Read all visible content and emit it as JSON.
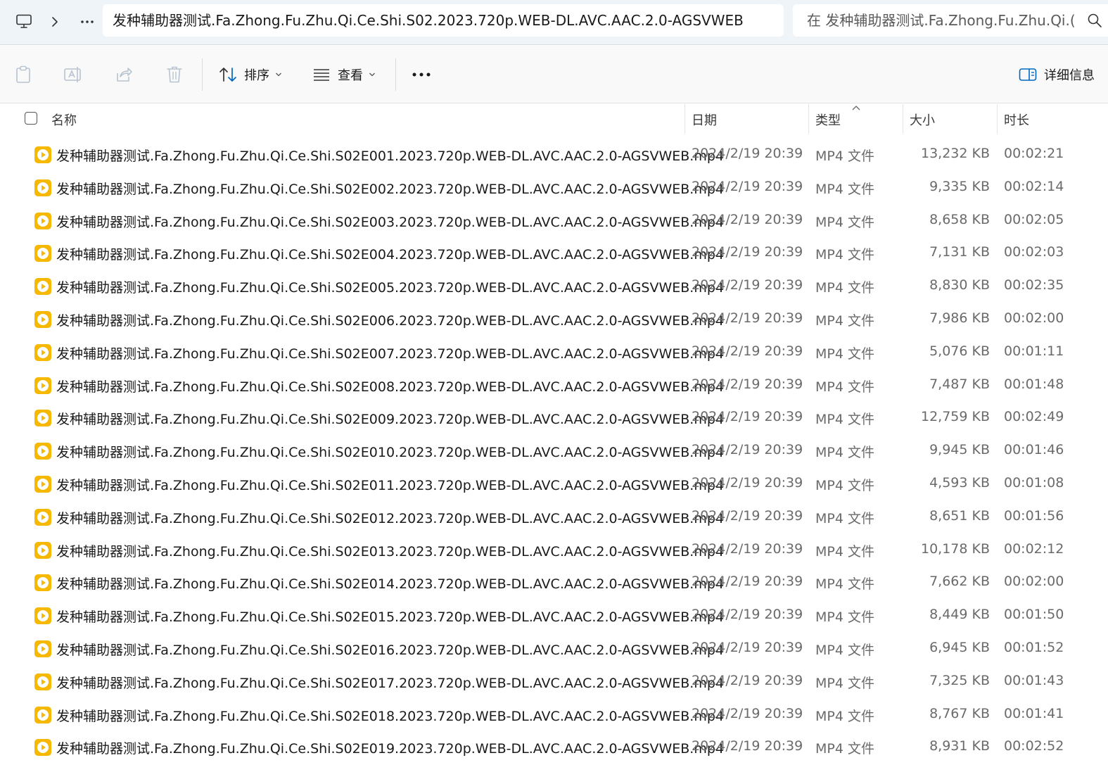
{
  "address_bar": {
    "breadcrumb": "发种辅助器测试.Fa.Zhong.Fu.Zhu.Qi.Ce.Shi.S02.2023.720p.WEB-DL.AVC.AAC.2.0-AGSVWEB",
    "search_placeholder": "在 发种辅助器测试.Fa.Zhong.Fu.Zhu.Qi.("
  },
  "toolbar": {
    "sort_label": "排序",
    "view_label": "查看",
    "details_label": "详细信息"
  },
  "columns": {
    "name": "名称",
    "date": "日期",
    "type": "类型",
    "size": "大小",
    "duration": "时长"
  },
  "files": [
    {
      "name": "发种辅助器测试.Fa.Zhong.Fu.Zhu.Qi.Ce.Shi.S02E001.2023.720p.WEB-DL.AVC.AAC.2.0-AGSVWEB.mp4",
      "date": "2024/2/19 20:39",
      "type": "MP4 文件",
      "size": "13,232 KB",
      "duration": "00:02:21"
    },
    {
      "name": "发种辅助器测试.Fa.Zhong.Fu.Zhu.Qi.Ce.Shi.S02E002.2023.720p.WEB-DL.AVC.AAC.2.0-AGSVWEB.mp4",
      "date": "2024/2/19 20:39",
      "type": "MP4 文件",
      "size": "9,335 KB",
      "duration": "00:02:14"
    },
    {
      "name": "发种辅助器测试.Fa.Zhong.Fu.Zhu.Qi.Ce.Shi.S02E003.2023.720p.WEB-DL.AVC.AAC.2.0-AGSVWEB.mp4",
      "date": "2024/2/19 20:39",
      "type": "MP4 文件",
      "size": "8,658 KB",
      "duration": "00:02:05"
    },
    {
      "name": "发种辅助器测试.Fa.Zhong.Fu.Zhu.Qi.Ce.Shi.S02E004.2023.720p.WEB-DL.AVC.AAC.2.0-AGSVWEB.mp4",
      "date": "2024/2/19 20:39",
      "type": "MP4 文件",
      "size": "7,131 KB",
      "duration": "00:02:03"
    },
    {
      "name": "发种辅助器测试.Fa.Zhong.Fu.Zhu.Qi.Ce.Shi.S02E005.2023.720p.WEB-DL.AVC.AAC.2.0-AGSVWEB.mp4",
      "date": "2024/2/19 20:39",
      "type": "MP4 文件",
      "size": "8,830 KB",
      "duration": "00:02:35"
    },
    {
      "name": "发种辅助器测试.Fa.Zhong.Fu.Zhu.Qi.Ce.Shi.S02E006.2023.720p.WEB-DL.AVC.AAC.2.0-AGSVWEB.mp4",
      "date": "2024/2/19 20:39",
      "type": "MP4 文件",
      "size": "7,986 KB",
      "duration": "00:02:00"
    },
    {
      "name": "发种辅助器测试.Fa.Zhong.Fu.Zhu.Qi.Ce.Shi.S02E007.2023.720p.WEB-DL.AVC.AAC.2.0-AGSVWEB.mp4",
      "date": "2024/2/19 20:39",
      "type": "MP4 文件",
      "size": "5,076 KB",
      "duration": "00:01:11"
    },
    {
      "name": "发种辅助器测试.Fa.Zhong.Fu.Zhu.Qi.Ce.Shi.S02E008.2023.720p.WEB-DL.AVC.AAC.2.0-AGSVWEB.mp4",
      "date": "2024/2/19 20:39",
      "type": "MP4 文件",
      "size": "7,487 KB",
      "duration": "00:01:48"
    },
    {
      "name": "发种辅助器测试.Fa.Zhong.Fu.Zhu.Qi.Ce.Shi.S02E009.2023.720p.WEB-DL.AVC.AAC.2.0-AGSVWEB.mp4",
      "date": "2024/2/19 20:39",
      "type": "MP4 文件",
      "size": "12,759 KB",
      "duration": "00:02:49"
    },
    {
      "name": "发种辅助器测试.Fa.Zhong.Fu.Zhu.Qi.Ce.Shi.S02E010.2023.720p.WEB-DL.AVC.AAC.2.0-AGSVWEB.mp4",
      "date": "2024/2/19 20:39",
      "type": "MP4 文件",
      "size": "9,945 KB",
      "duration": "00:01:46"
    },
    {
      "name": "发种辅助器测试.Fa.Zhong.Fu.Zhu.Qi.Ce.Shi.S02E011.2023.720p.WEB-DL.AVC.AAC.2.0-AGSVWEB.mp4",
      "date": "2024/2/19 20:39",
      "type": "MP4 文件",
      "size": "4,593 KB",
      "duration": "00:01:08"
    },
    {
      "name": "发种辅助器测试.Fa.Zhong.Fu.Zhu.Qi.Ce.Shi.S02E012.2023.720p.WEB-DL.AVC.AAC.2.0-AGSVWEB.mp4",
      "date": "2024/2/19 20:39",
      "type": "MP4 文件",
      "size": "8,651 KB",
      "duration": "00:01:56"
    },
    {
      "name": "发种辅助器测试.Fa.Zhong.Fu.Zhu.Qi.Ce.Shi.S02E013.2023.720p.WEB-DL.AVC.AAC.2.0-AGSVWEB.mp4",
      "date": "2024/2/19 20:39",
      "type": "MP4 文件",
      "size": "10,178 KB",
      "duration": "00:02:12"
    },
    {
      "name": "发种辅助器测试.Fa.Zhong.Fu.Zhu.Qi.Ce.Shi.S02E014.2023.720p.WEB-DL.AVC.AAC.2.0-AGSVWEB.mp4",
      "date": "2024/2/19 20:39",
      "type": "MP4 文件",
      "size": "7,662 KB",
      "duration": "00:02:00"
    },
    {
      "name": "发种辅助器测试.Fa.Zhong.Fu.Zhu.Qi.Ce.Shi.S02E015.2023.720p.WEB-DL.AVC.AAC.2.0-AGSVWEB.mp4",
      "date": "2024/2/19 20:39",
      "type": "MP4 文件",
      "size": "8,449 KB",
      "duration": "00:01:50"
    },
    {
      "name": "发种辅助器测试.Fa.Zhong.Fu.Zhu.Qi.Ce.Shi.S02E016.2023.720p.WEB-DL.AVC.AAC.2.0-AGSVWEB.mp4",
      "date": "2024/2/19 20:39",
      "type": "MP4 文件",
      "size": "6,945 KB",
      "duration": "00:01:52"
    },
    {
      "name": "发种辅助器测试.Fa.Zhong.Fu.Zhu.Qi.Ce.Shi.S02E017.2023.720p.WEB-DL.AVC.AAC.2.0-AGSVWEB.mp4",
      "date": "2024/2/19 20:39",
      "type": "MP4 文件",
      "size": "7,325 KB",
      "duration": "00:01:43"
    },
    {
      "name": "发种辅助器测试.Fa.Zhong.Fu.Zhu.Qi.Ce.Shi.S02E018.2023.720p.WEB-DL.AVC.AAC.2.0-AGSVWEB.mp4",
      "date": "2024/2/19 20:39",
      "type": "MP4 文件",
      "size": "8,767 KB",
      "duration": "00:01:41"
    },
    {
      "name": "发种辅助器测试.Fa.Zhong.Fu.Zhu.Qi.Ce.Shi.S02E019.2023.720p.WEB-DL.AVC.AAC.2.0-AGSVWEB.mp4",
      "date": "2024/2/19 20:39",
      "type": "MP4 文件",
      "size": "8,931 KB",
      "duration": "00:02:52"
    }
  ],
  "icons": {
    "file_icon": "video-file-icon",
    "file_icon_color": "#f6b800",
    "accent_color": "#0067c0"
  }
}
